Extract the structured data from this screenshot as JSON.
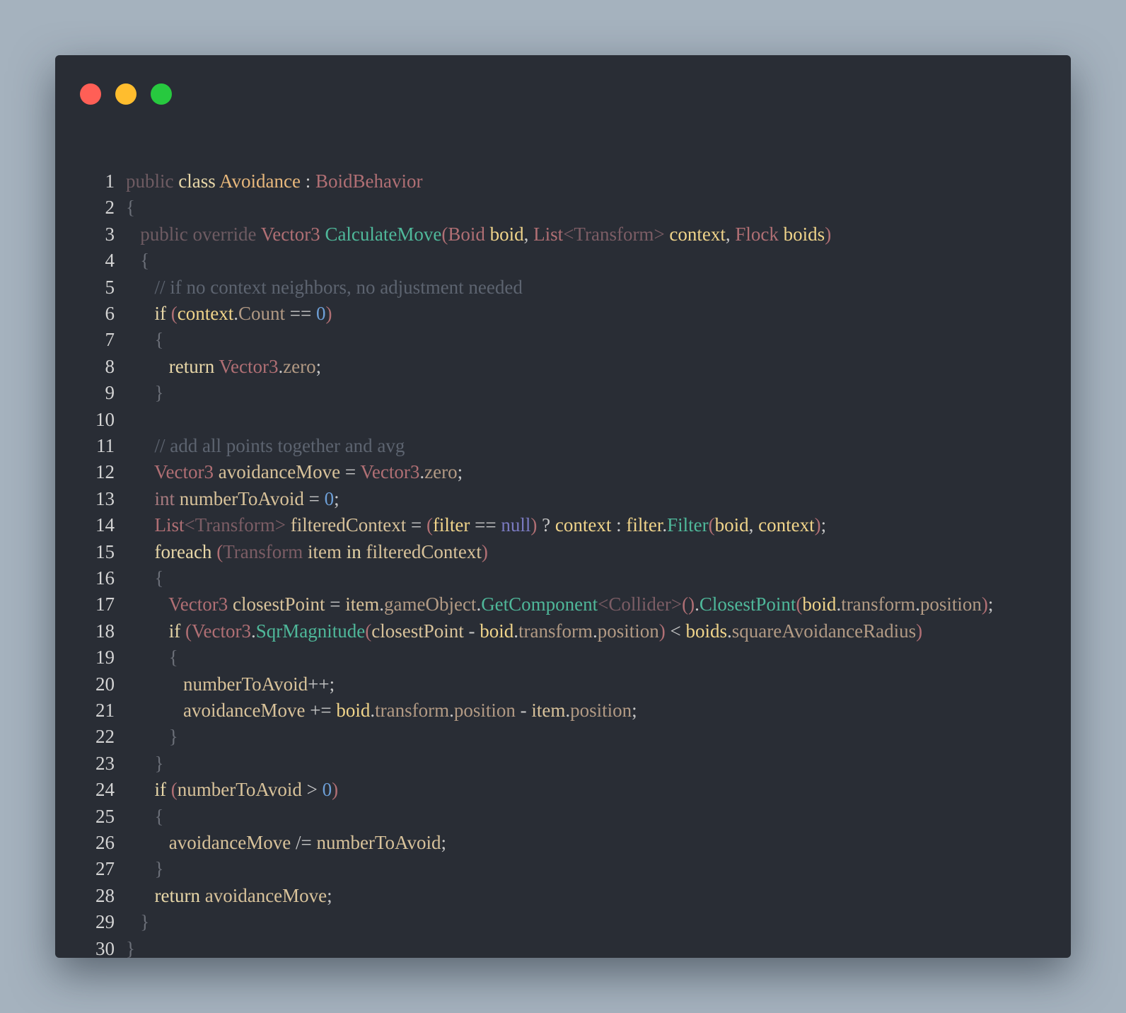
{
  "window": {
    "controls": {
      "close_color": "#ff5f56",
      "minimize_color": "#ffbd2e",
      "maximize_color": "#27c93f"
    }
  },
  "code": {
    "language": "C#",
    "lines": [
      {
        "n": "1",
        "text": "public class Avoidance : BoidBehavior"
      },
      {
        "n": "2",
        "text": "{"
      },
      {
        "n": "3",
        "text": "   public override Vector3 CalculateMove(Boid boid, List<Transform> context, Flock boids)"
      },
      {
        "n": "4",
        "text": "   {"
      },
      {
        "n": "5",
        "text": "      // if no context neighbors, no adjustment needed"
      },
      {
        "n": "6",
        "text": "      if (context.Count == 0)"
      },
      {
        "n": "7",
        "text": "      {"
      },
      {
        "n": "8",
        "text": "         return Vector3.zero;"
      },
      {
        "n": "9",
        "text": "      }"
      },
      {
        "n": "10",
        "text": ""
      },
      {
        "n": "11",
        "text": "      // add all points together and avg"
      },
      {
        "n": "12",
        "text": "      Vector3 avoidanceMove = Vector3.zero;"
      },
      {
        "n": "13",
        "text": "      int numberToAvoid = 0;"
      },
      {
        "n": "14",
        "text": "      List<Transform> filteredContext = (filter == null) ? context : filter.Filter(boid, context);"
      },
      {
        "n": "15",
        "text": "      foreach (Transform item in filteredContext)"
      },
      {
        "n": "16",
        "text": "      {"
      },
      {
        "n": "17",
        "text": "         Vector3 closestPoint = item.gameObject.GetComponent<Collider>().ClosestPoint(boid.transform.position);"
      },
      {
        "n": "18",
        "text": "         if (Vector3.SqrMagnitude(closestPoint - boid.transform.position) < boids.squareAvoidanceRadius)"
      },
      {
        "n": "19",
        "text": "         {"
      },
      {
        "n": "20",
        "text": "            numberToAvoid++;"
      },
      {
        "n": "21",
        "text": "            avoidanceMove += boid.transform.position - item.position;"
      },
      {
        "n": "22",
        "text": "         }"
      },
      {
        "n": "23",
        "text": "      }"
      },
      {
        "n": "24",
        "text": "      if (numberToAvoid > 0)"
      },
      {
        "n": "25",
        "text": "      {"
      },
      {
        "n": "26",
        "text": "         avoidanceMove /= numberToAvoid;"
      },
      {
        "n": "27",
        "text": "      }"
      },
      {
        "n": "28",
        "text": "      return avoidanceMove;"
      },
      {
        "n": "29",
        "text": "   }"
      },
      {
        "n": "30",
        "text": "}"
      }
    ]
  }
}
